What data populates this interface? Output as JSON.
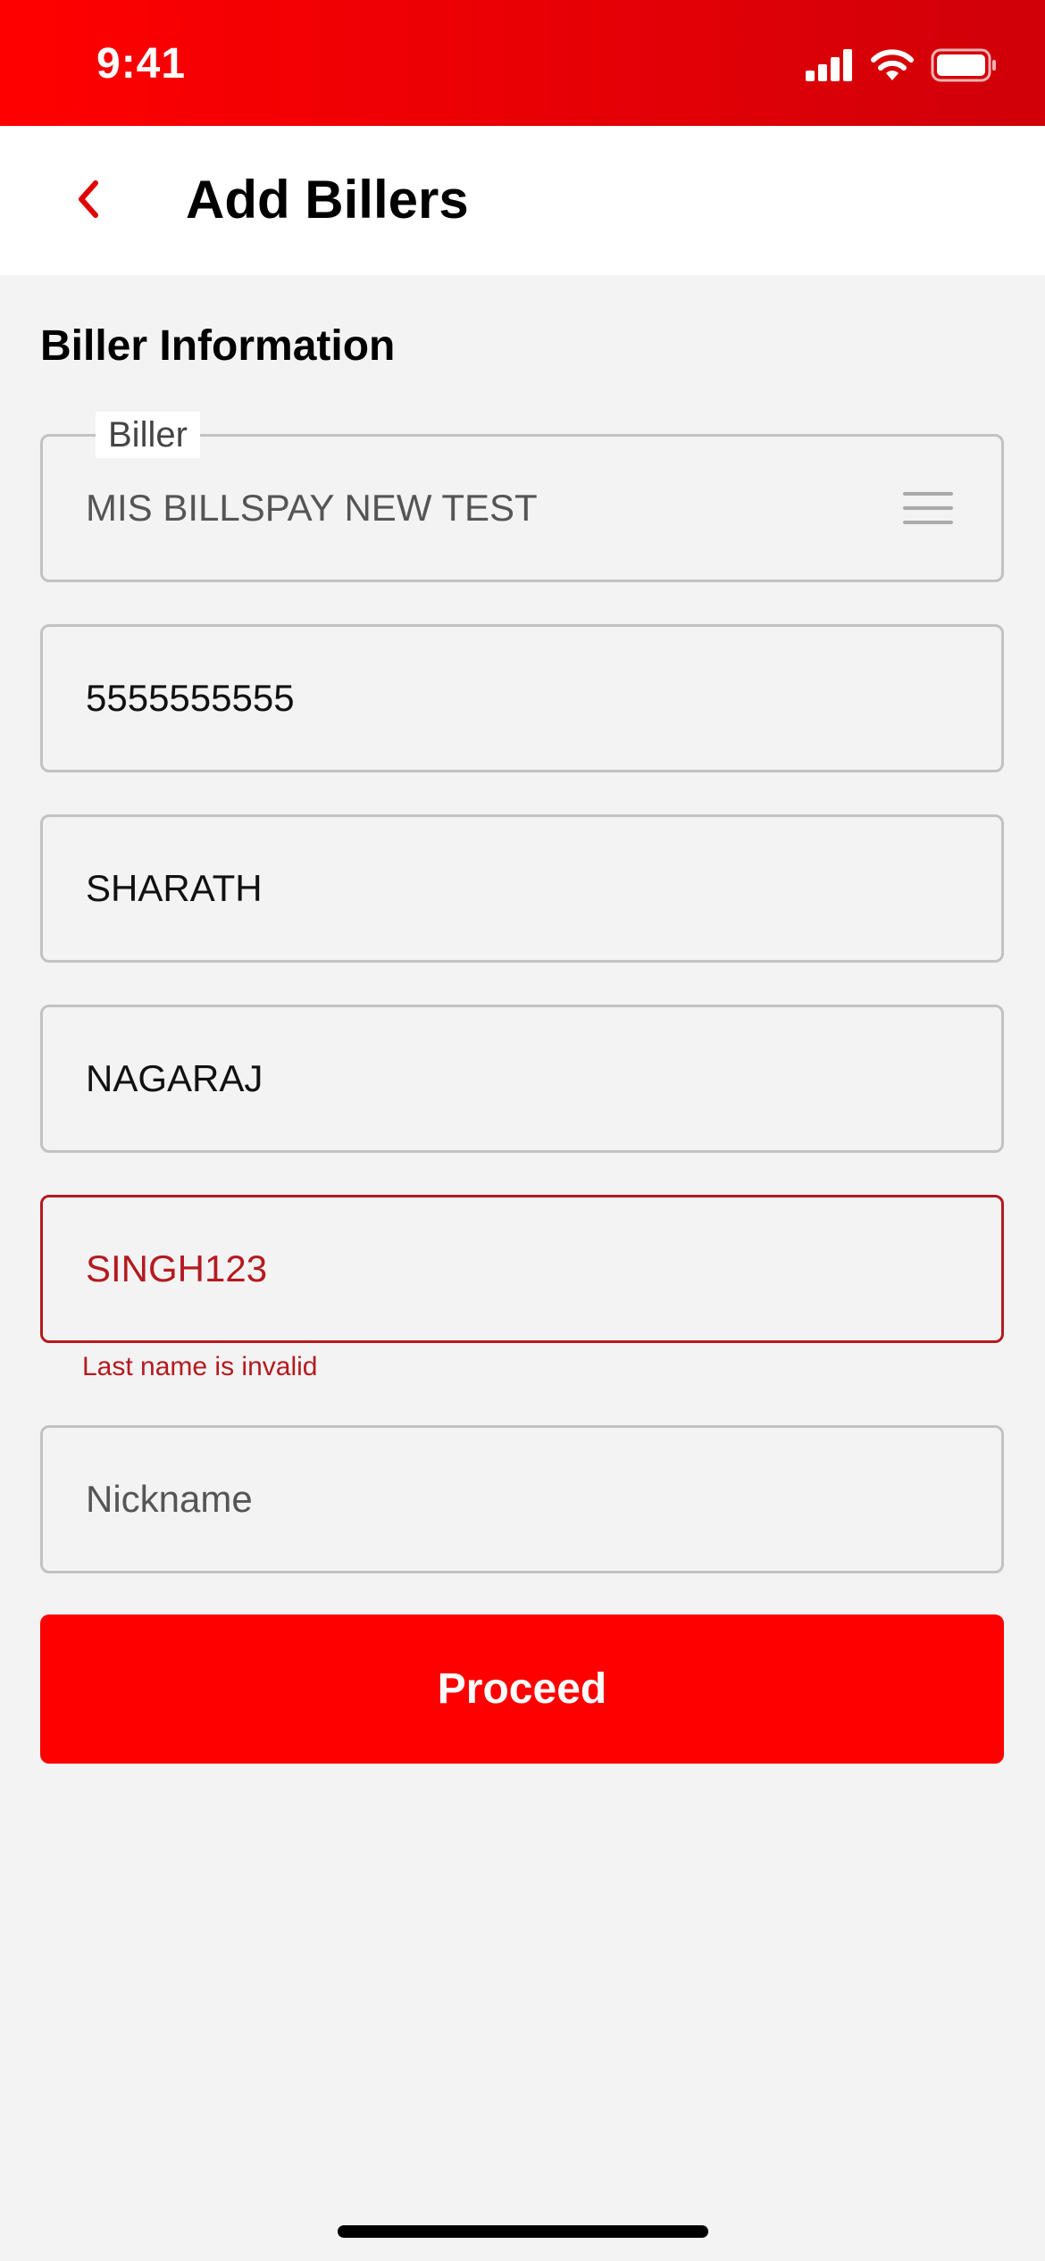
{
  "status_bar": {
    "time": "9:41",
    "icons": [
      "cellular-signal-icon",
      "wifi-icon",
      "battery-icon"
    ]
  },
  "header": {
    "back_icon": "chevron-left-icon",
    "title": "Add Billers"
  },
  "section": {
    "title": "Biller Information"
  },
  "form": {
    "biller": {
      "label": "Biller",
      "value": "MIS BILLSPAY NEW TEST",
      "icon": "menu-icon"
    },
    "account_number": {
      "value": "5555555555"
    },
    "first_name": {
      "value": "SHARATH"
    },
    "middle_name": {
      "value": "NAGARAJ"
    },
    "last_name": {
      "value": "SINGH123",
      "error": "Last name is invalid"
    },
    "nickname": {
      "placeholder": "Nickname"
    }
  },
  "actions": {
    "proceed_label": "Proceed"
  },
  "colors": {
    "brand_red": "#ff0000",
    "error_red": "#b41a1f",
    "background": "#f3f3f3"
  }
}
